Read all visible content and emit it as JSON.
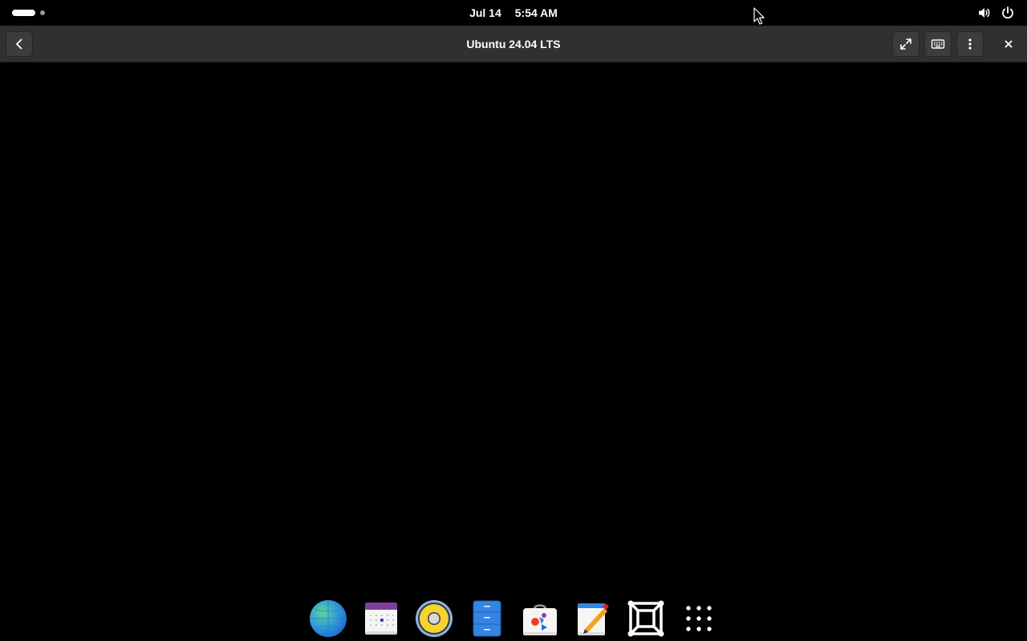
{
  "topbar": {
    "date": "Jul 14",
    "time": "5:54 AM",
    "tray_icons": [
      "volume-icon",
      "power-icon"
    ]
  },
  "viewer": {
    "title": "Ubuntu 24.04 LTS",
    "buttons": [
      "back-button",
      "fullscreen-button",
      "keyboard-button",
      "menu-button",
      "close-button"
    ]
  },
  "dock": {
    "apps": [
      "web-browser",
      "calendar",
      "rhythmbox-music",
      "files",
      "software-store",
      "text-editor",
      "boxes",
      "show-apps"
    ]
  }
}
